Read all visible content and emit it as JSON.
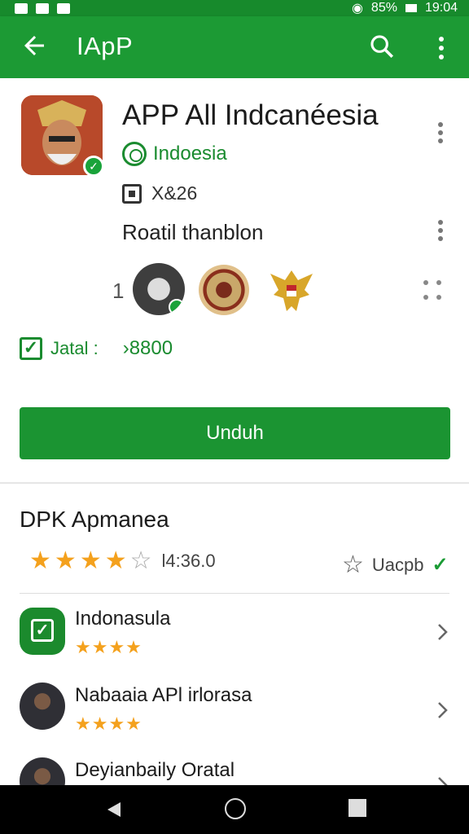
{
  "status_bar": {
    "battery": "85%",
    "time": "19:04"
  },
  "appbar": {
    "title": "IApP",
    "back_icon": "arrow-left-icon",
    "search_icon": "search-icon",
    "more_icon": "more-vertical-icon"
  },
  "app": {
    "title": "APP All Indcanéesia",
    "developer": "Indoesia",
    "meta": "X&26",
    "rating_label": "Roatil thanblon",
    "count": "1",
    "jatal_label": "Jatal :",
    "jatal_value": "›8800"
  },
  "install_button": "Unduh",
  "section": {
    "title": "DPK Apmanea",
    "score": "l4:36.0",
    "wish_label": "Uacpb"
  },
  "list": [
    {
      "title": "Indonasula",
      "stars": "★★★★"
    },
    {
      "title": "Nabaaia APl irlorasa",
      "stars": "★★★★"
    },
    {
      "title": "Deyianbaily Oratal",
      "stars": ""
    }
  ],
  "colors": {
    "primary": "#1c9a34",
    "accent": "#f4a11d"
  }
}
